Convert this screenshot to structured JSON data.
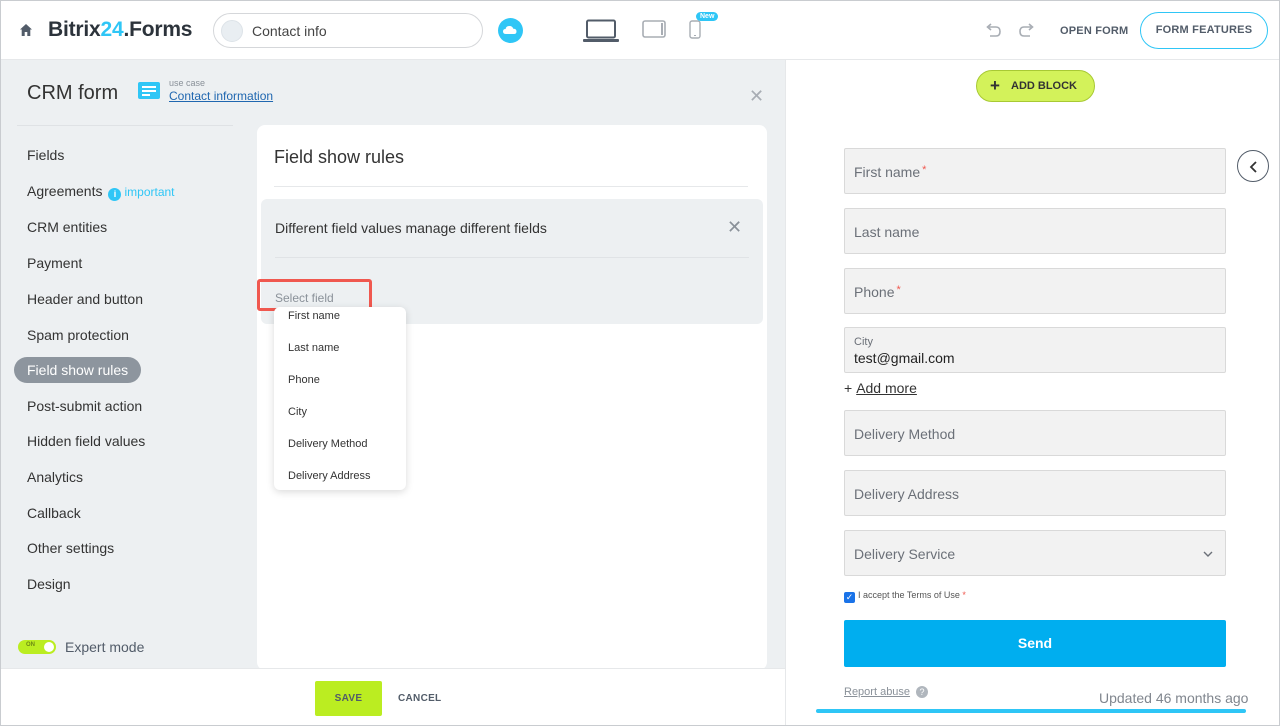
{
  "topbar": {
    "brand_part1": "Bitrix",
    "brand_accent": "24",
    "brand_part2": ".Forms",
    "form_name": "Contact info",
    "new_badge": "New",
    "open_form": "OPEN FORM",
    "form_features": "FORM FEATURES"
  },
  "left": {
    "title": "CRM form",
    "usecase_label": "use case",
    "usecase_link": "Contact information",
    "menu": [
      {
        "label": "Fields"
      },
      {
        "label": "Agreements",
        "badge": "important"
      },
      {
        "label": "CRM entities"
      },
      {
        "label": "Payment"
      },
      {
        "label": "Header and button"
      },
      {
        "label": "Spam protection"
      },
      {
        "label": "Field show rules",
        "active": true
      },
      {
        "label": "Post-submit action"
      },
      {
        "label": "Hidden field values"
      },
      {
        "label": "Analytics"
      },
      {
        "label": "Callback"
      },
      {
        "label": "Other settings"
      },
      {
        "label": "Design"
      }
    ],
    "expert_toggle": "ON",
    "expert_label": "Expert mode"
  },
  "card": {
    "title": "Field show rules",
    "rule_title": "Different field values manage different fields",
    "select_placeholder": "Select field",
    "dropdown": [
      "First name",
      "Last name",
      "Phone",
      "City",
      "Delivery Method",
      "Delivery Address"
    ]
  },
  "bottom": {
    "save": "SAVE",
    "cancel": "CANCEL"
  },
  "preview": {
    "add_block": "ADD BLOCK",
    "first_name": "First name",
    "last_name": "Last name",
    "phone": "Phone",
    "city_label": "City",
    "city_value": "test@gmail.com",
    "add_more": "Add more",
    "delivery_method": "Delivery Method",
    "delivery_address": "Delivery Address",
    "delivery_service": "Delivery Service",
    "terms": "I accept the Terms of Use",
    "required_mark": "*",
    "send": "Send",
    "report_abuse": "Report abuse",
    "updated": "Updated 46 months ago"
  },
  "colors": {
    "accent": "#2fc6f6",
    "lime": "#bbed21",
    "send": "#00aeef",
    "highlight": "#f0584f"
  }
}
